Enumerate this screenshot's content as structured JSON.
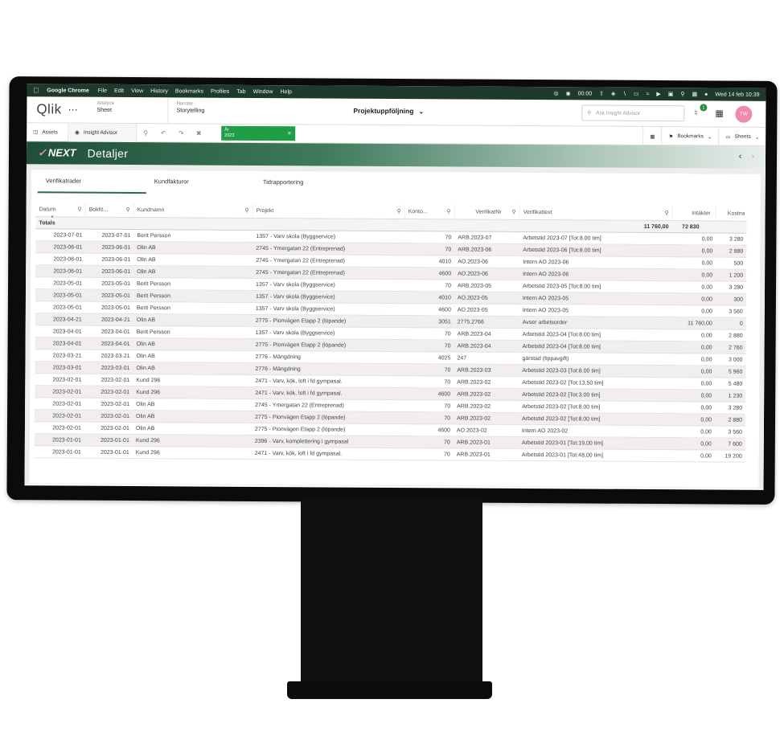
{
  "menubar": {
    "app": "Google Chrome",
    "items": [
      "File",
      "Edit",
      "View",
      "History",
      "Bookmarks",
      "Profiles",
      "Tab",
      "Window",
      "Help"
    ],
    "timer": "00:00",
    "datetime": "Wed 14 feb 10:39"
  },
  "qlik": {
    "logo": "Qlik",
    "analyze": {
      "sub": "Analyze",
      "main": "Sheet"
    },
    "narrate": {
      "sub": "Narrate",
      "main": "Storytelling"
    },
    "app_title": "Projektuppföljning",
    "ask_placeholder": "Ask Insight Advisor",
    "notification_count": "1",
    "avatar_initials": "TW"
  },
  "toolbar": {
    "assets": "Assets",
    "insight": "Insight Advisor",
    "selection_field": "År",
    "selection_value": "2023",
    "bookmarks": "Bookmarks",
    "sheets": "Sheets"
  },
  "sheet": {
    "logo": "NEXT",
    "title": "Detaljer"
  },
  "tabs": [
    "Verifikatrader",
    "Kundfakturor",
    "Tidrapportering"
  ],
  "table": {
    "headers": {
      "datum": "Datum",
      "bokf": "Bokfö...",
      "kund": "Kundnamn",
      "proj": "Projekt",
      "konto": "Konto...",
      "vnr": "VerifikatNr",
      "vtext": "Verifikattext",
      "int": "Intäkter",
      "kost": "Kostna"
    },
    "totals": {
      "label": "Totals",
      "int": "11 760,00",
      "kost": "72 830"
    },
    "rows": [
      [
        "2023-07-01",
        "2023-07-01",
        "Berit Persson",
        "1357 - Varv skola (Byggservice)",
        "70",
        "ARB.2023-07",
        "Arbetstid 2023-07 [Tot:8.00 tim]",
        "0,00",
        "3 280"
      ],
      [
        "2023-06-01",
        "2023-06-01",
        "Olin AB",
        "2745 - Ymergatan 22 (Entreprenad)",
        "70",
        "ARB.2023-06",
        "Arbetstid 2023-06 [Tot:8.00 tim]",
        "0,00",
        "2 880"
      ],
      [
        "2023-06-01",
        "2023-06-01",
        "Olin AB",
        "2745 - Ymergatan 22 (Entreprenad)",
        "4010",
        "AO.2023-06",
        "Intern AO 2023-06",
        "0,00",
        "500"
      ],
      [
        "2023-06-01",
        "2023-06-01",
        "Olin AB",
        "2745 - Ymergatan 22 (Entreprenad)",
        "4600",
        "AO.2023-06",
        "Intern AO 2023-06",
        "0,00",
        "1 200"
      ],
      [
        "2023-05-01",
        "2023-05-01",
        "Berit Persson",
        "1357 - Varv skola (Byggservice)",
        "70",
        "ARB.2023-05",
        "Arbetstid 2023-05 [Tot:8.00 tim]",
        "0,00",
        "3 280"
      ],
      [
        "2023-05-01",
        "2023-05-01",
        "Berit Persson",
        "1357 - Varv skola (Byggservice)",
        "4010",
        "AO.2023-05",
        "Intern AO 2023-05",
        "0,00",
        "300"
      ],
      [
        "2023-05-01",
        "2023-05-01",
        "Berit Persson",
        "1357 - Varv skola (Byggservice)",
        "4600",
        "AO.2023-05",
        "Intern AO 2023-05",
        "0,00",
        "3 560"
      ],
      [
        "2023-04-21",
        "2023-04-21",
        "Olin AB",
        "2775 - Pionvägen Etapp 2 (löpande)",
        "3051",
        "2775.2766",
        "Avser arbetsorder",
        "11 760,00",
        "0"
      ],
      [
        "2023-04-01",
        "2023-04-01",
        "Berit Persson",
        "1357 - Varv skola (Byggservice)",
        "70",
        "ARB.2023-04",
        "Arbetstid 2023-04 [Tot:8.00 tim]",
        "0,00",
        "2 880"
      ],
      [
        "2023-04-01",
        "2023-04-01",
        "Olin AB",
        "2775 - Pionvägen Etapp 2 (löpande)",
        "70",
        "ARB.2023-04",
        "Arbetstid 2023-04 [Tot:8.00 tim]",
        "0,00",
        "2 760"
      ],
      [
        "2023-03-21",
        "2023-03-21",
        "Olin AB",
        "2776 - Mängdning",
        "4025",
        "247",
        "gärstad (tippavgift)",
        "0,00",
        "3 000"
      ],
      [
        "2023-03-01",
        "2023-03-01",
        "Olin AB",
        "2776 - Mängdning",
        "70",
        "ARB.2023-03",
        "Arbetstid 2023-03 [Tot:8.00 tim]",
        "0,00",
        "5 960"
      ],
      [
        "2023-02-01",
        "2023-02-01",
        "Kund 296",
        "2471 - Varv, kök, loft i fd gympasal.",
        "70",
        "ARB.2023-02",
        "Arbetstid 2023-02 [Tot:13,50 tim]",
        "0,00",
        "5 480"
      ],
      [
        "2023-02-01",
        "2023-02-01",
        "Kund 296",
        "2471 - Varv, kök, loft i fd gympasal.",
        "4600",
        "ARB.2023-02",
        "Arbetstid 2023-02 [Tot:3.00 tim]",
        "0,00",
        "1 230"
      ],
      [
        "2023-02-01",
        "2023-02-01",
        "Olin AB",
        "2745 - Ymergatan 22 (Entreprenad)",
        "70",
        "ARB.2023-02",
        "Arbetstid 2023-02 [Tot:8.00 tim]",
        "0,00",
        "3 280"
      ],
      [
        "2023-02-01",
        "2023-02-01",
        "Olin AB",
        "2775 - Pionvägen Etapp 2 (löpande)",
        "70",
        "ARB.2023-02",
        "Arbetstid 2023-02 [Tot:8.00 tim]",
        "0,00",
        "2 880"
      ],
      [
        "2023-02-01",
        "2023-02-01",
        "Olin AB",
        "2775 - Pionvägen Etapp 2 (löpande)",
        "4600",
        "AO.2023-02",
        "Intern AO 2023-02",
        "0,00",
        "3 560"
      ],
      [
        "2023-01-01",
        "2023-01-01",
        "Kund 296",
        "2396 - Varv, komplettering i gympasal",
        "70",
        "ARB.2023-01",
        "Arbetstid 2023-01 [Tot:19,00 tim]",
        "0,00",
        "7 600"
      ],
      [
        "2023-01-01",
        "2023-01-01",
        "Kund 296",
        "2471 - Varv, kök, loft i fd gympasal.",
        "70",
        "ARB.2023-01",
        "Arbetstid 2023-01 [Tot:48,00 tim]",
        "0,00",
        "19 200"
      ]
    ]
  }
}
